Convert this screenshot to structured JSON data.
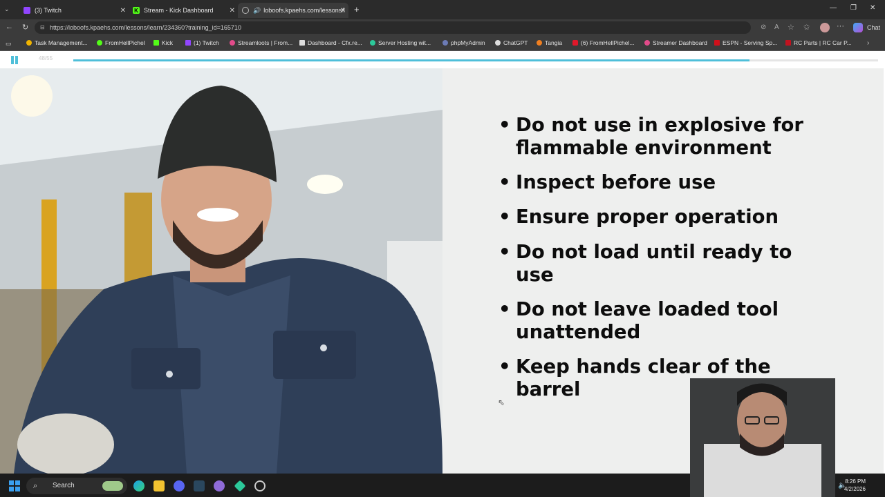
{
  "browser": {
    "tabs": [
      {
        "label": "(3) Twitch",
        "active": false
      },
      {
        "label": "Stream - Kick Dashboard",
        "active": false
      },
      {
        "label": "loboofs.kpaehs.com/lessons/l",
        "active": true
      }
    ],
    "url": "https://loboofs.kpaehs.com/lessons/learn/234360?training_id=165710",
    "chat_label": "Chat",
    "bookmarks": [
      "Task Management...",
      "FromHellPichel",
      "Kick",
      "(1) Twitch",
      "Streamloots | From...",
      "Dashboard - Cfx.re...",
      "Server Hosting wit...",
      "phpMyAdmin",
      "ChatGPT",
      "Tangia",
      "(6) FromHellPichel...",
      "Streamer Dashboard",
      "ESPN - Serving Sp...",
      "RC Parts | RC Car P..."
    ]
  },
  "player": {
    "slide_counter": "48/55",
    "progress_fraction": 0.84,
    "bullets": [
      {
        "line1": "Do not use in explosive for",
        "line2": "flammable environment"
      },
      {
        "line1": "Inspect before use",
        "line2": ""
      },
      {
        "line1": "Ensure proper operation",
        "line2": ""
      },
      {
        "line1": "Do not load until ready to",
        "line2": "use"
      },
      {
        "line1": "Do not leave loaded tool",
        "line2": "unattended"
      },
      {
        "line1": "Keep hands clear of the",
        "line2": "barrel"
      }
    ]
  },
  "taskbar": {
    "search_label": "Search",
    "time": "8:26 PM",
    "date": "4/2/2026"
  },
  "colors": {
    "accent": "#4fbfd9",
    "slide_bg": "#eeefee",
    "text": "#0d0d0d"
  }
}
